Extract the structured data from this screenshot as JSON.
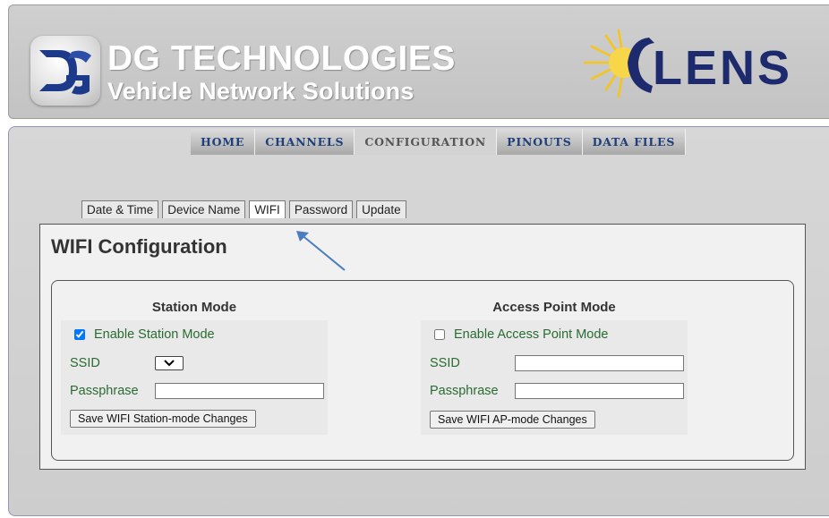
{
  "header": {
    "company_name": "DG TECHNOLOGIES",
    "tagline": "Vehicle Network Solutions",
    "product_logo_text": "LENS",
    "accent_colors": {
      "dg_blue": "#1d3a8a",
      "lens_navy": "#1d2b6e",
      "sun_yellow": "#f5c518"
    }
  },
  "nav": {
    "items": [
      {
        "label": "HOME"
      },
      {
        "label": "CHANNELS"
      },
      {
        "label": "CONFIGURATION",
        "active": true
      },
      {
        "label": "PINOUTS"
      },
      {
        "label": "DATA FILES"
      }
    ]
  },
  "subtabs": {
    "items": [
      {
        "label": "Date & Time"
      },
      {
        "label": "Device Name"
      },
      {
        "label": "WIFI",
        "active": true
      },
      {
        "label": "Password"
      },
      {
        "label": "Update"
      }
    ]
  },
  "panel": {
    "title": "WIFI Configuration"
  },
  "station": {
    "heading": "Station Mode",
    "enable_label": "Enable Station Mode",
    "enable_checked": true,
    "ssid_label": "SSID",
    "ssid_value": "",
    "passphrase_label": "Passphrase",
    "passphrase_value": "",
    "save_label": "Save WIFI Station-mode Changes"
  },
  "access_point": {
    "heading": "Access Point Mode",
    "enable_label": "Enable Access Point Mode",
    "enable_checked": false,
    "ssid_label": "SSID",
    "ssid_value": "",
    "passphrase_label": "Passphrase",
    "passphrase_value": "",
    "save_label": "Save WIFI AP-mode Changes"
  },
  "annotation": {
    "arrow_icon": "arrow-up-left-icon",
    "arrow_color": "#4a7ec0"
  }
}
